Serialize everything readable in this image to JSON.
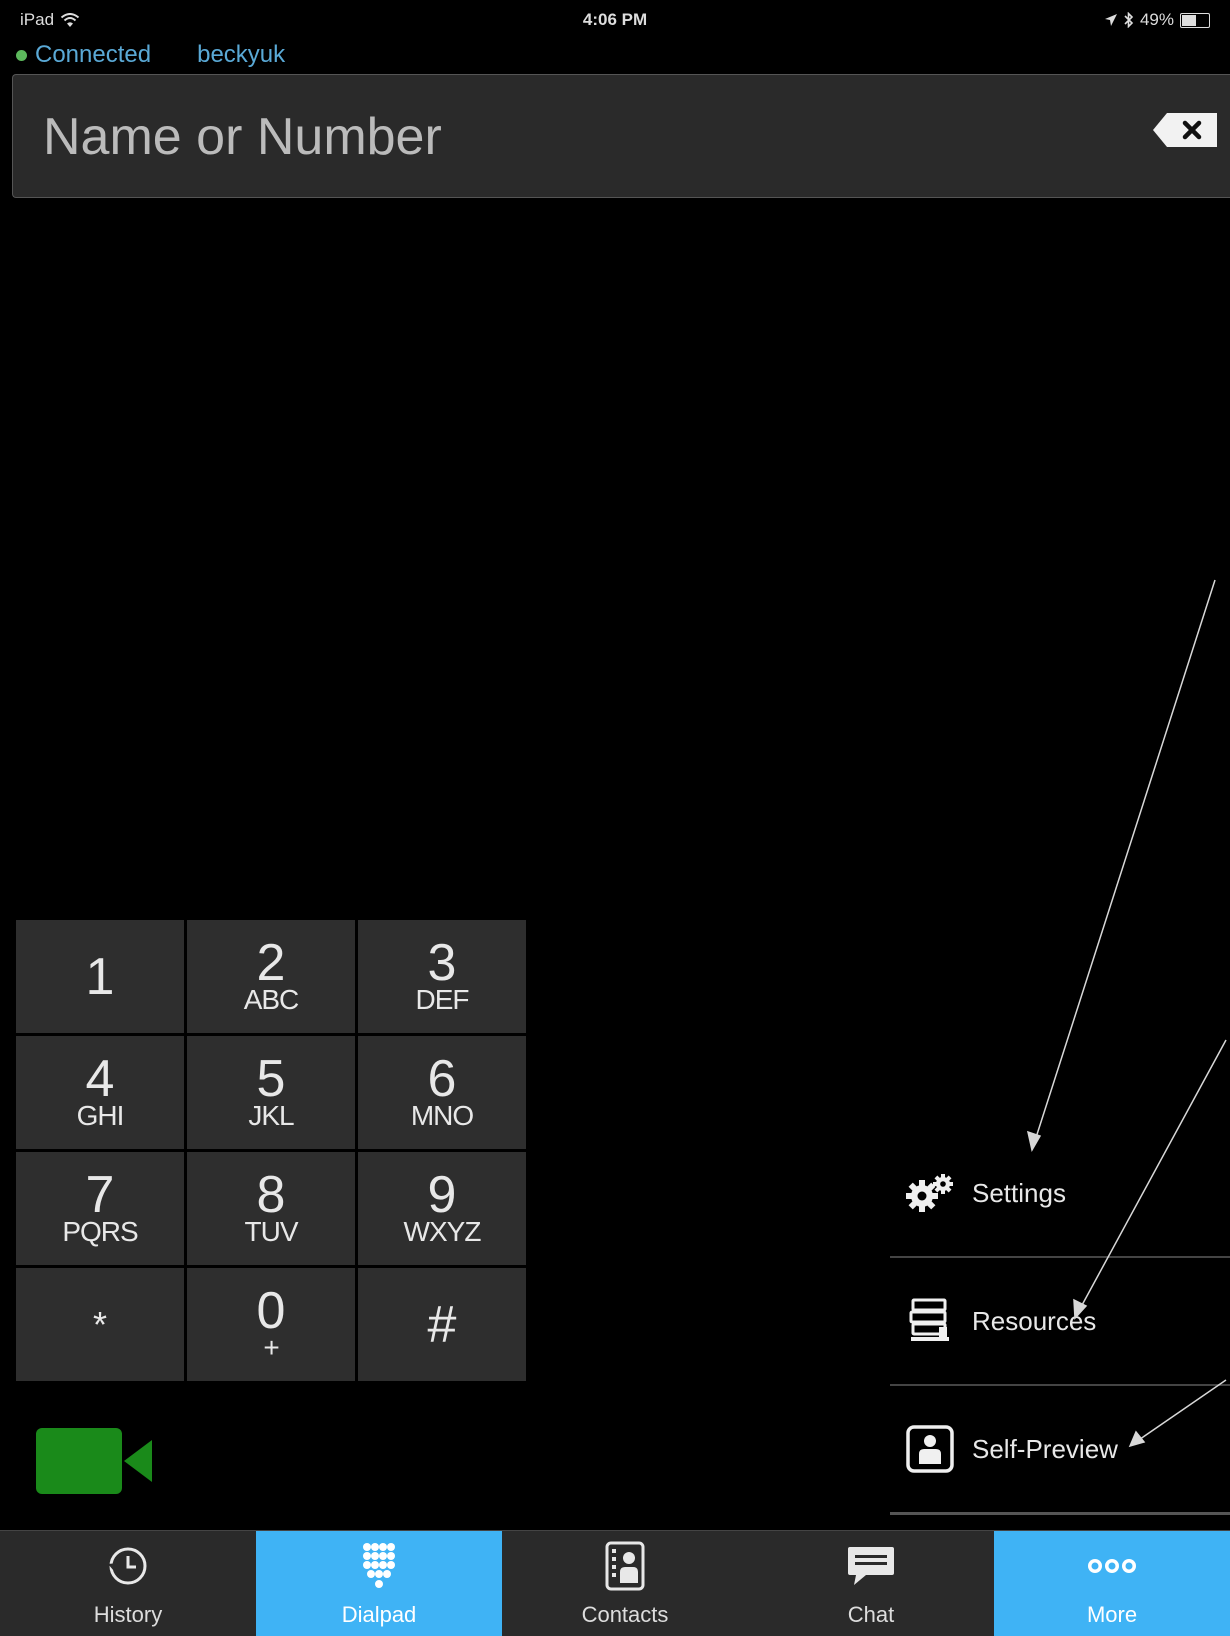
{
  "status_bar": {
    "device": "iPad",
    "time": "4:06 PM",
    "battery": "49%",
    "battery_level": 0.49
  },
  "connection": {
    "status": "Connected",
    "username": "beckyuk"
  },
  "search": {
    "placeholder": "Name or Number"
  },
  "keypad": {
    "keys": [
      {
        "digit": "1",
        "letters": ""
      },
      {
        "digit": "2",
        "letters": "ABC"
      },
      {
        "digit": "3",
        "letters": "DEF"
      },
      {
        "digit": "4",
        "letters": "GHI"
      },
      {
        "digit": "5",
        "letters": "JKL"
      },
      {
        "digit": "6",
        "letters": "MNO"
      },
      {
        "digit": "7",
        "letters": "PQRS"
      },
      {
        "digit": "8",
        "letters": "TUV"
      },
      {
        "digit": "9",
        "letters": "WXYZ"
      },
      {
        "digit": "*",
        "letters": ""
      },
      {
        "digit": "0",
        "letters": "+"
      },
      {
        "digit": "#",
        "letters": ""
      }
    ]
  },
  "more_menu": {
    "items": [
      {
        "label": "Settings",
        "icon": "gears-icon"
      },
      {
        "label": "Resources",
        "icon": "books-icon"
      },
      {
        "label": "Self-Preview",
        "icon": "self-preview-icon"
      }
    ]
  },
  "tabs": [
    {
      "label": "History",
      "icon": "clock-icon",
      "active": false
    },
    {
      "label": "Dialpad",
      "icon": "dialpad-icon",
      "active": true
    },
    {
      "label": "Contacts",
      "icon": "contacts-icon",
      "active": false
    },
    {
      "label": "Chat",
      "icon": "chat-icon",
      "active": false
    },
    {
      "label": "More",
      "icon": "more-dots-icon",
      "active": true
    }
  ],
  "colors": {
    "accent": "#3fb3f5",
    "connected_dot": "#5cb85c",
    "video_button": "#1a8a1a"
  }
}
